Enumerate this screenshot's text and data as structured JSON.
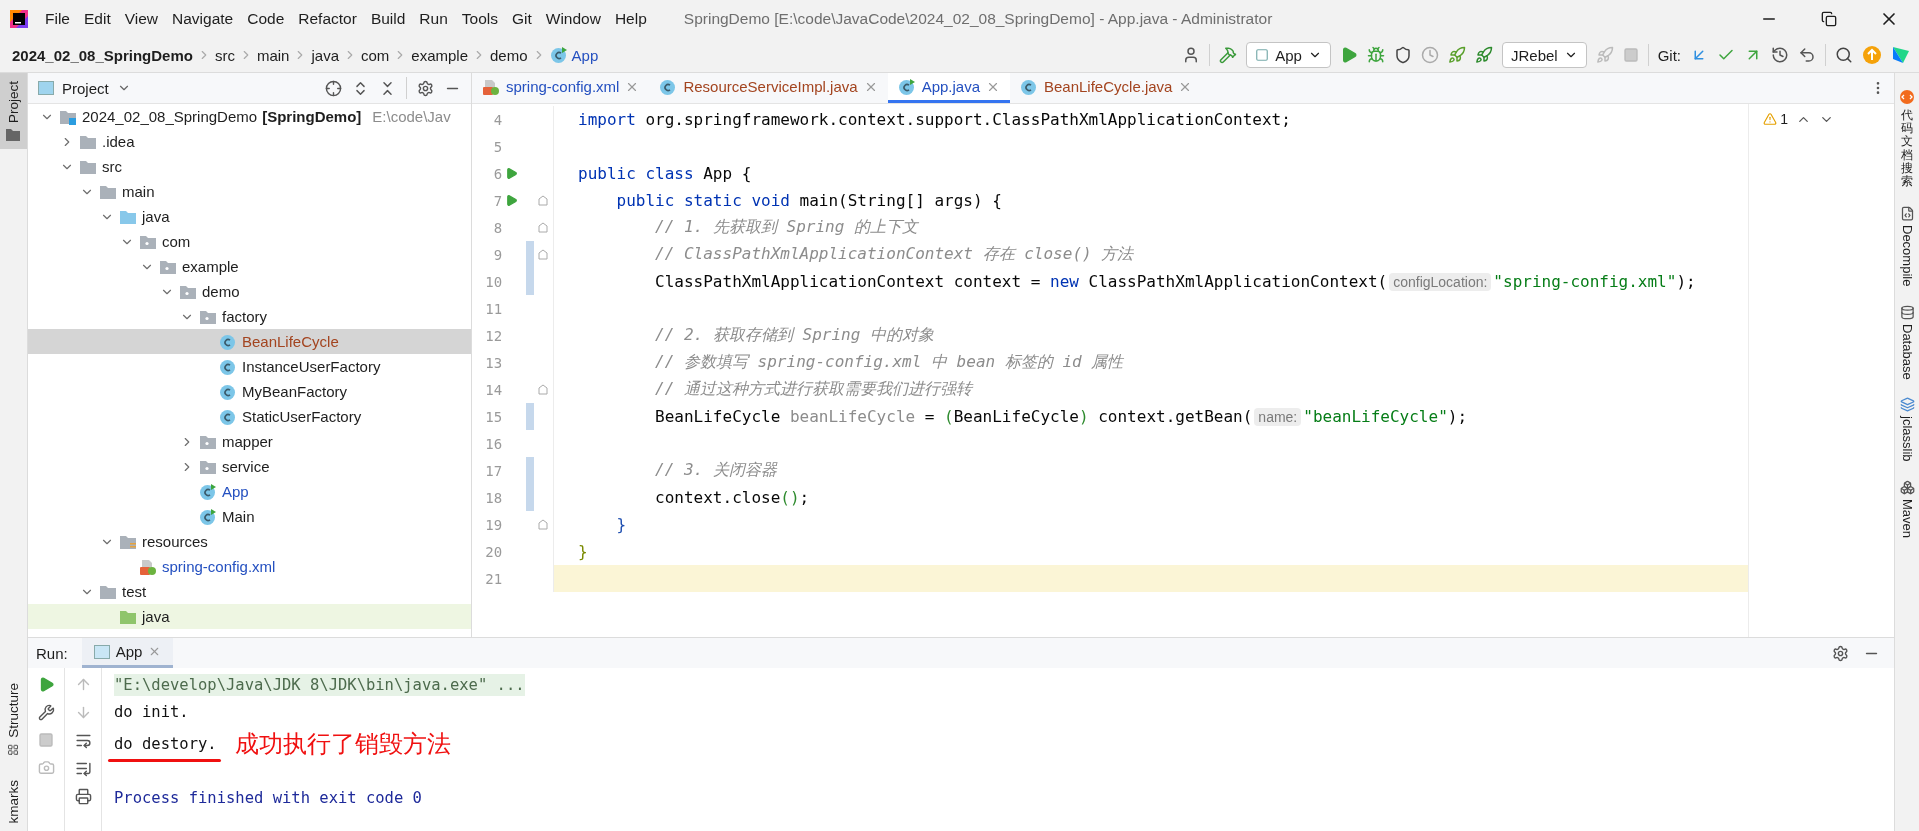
{
  "window": {
    "title": "SpringDemo [E:\\code\\JavaCode\\2024_02_08_SpringDemo] - App.java - Administrator"
  },
  "menu": [
    "File",
    "Edit",
    "View",
    "Navigate",
    "Code",
    "Refactor",
    "Build",
    "Run",
    "Tools",
    "Git",
    "Window",
    "Help"
  ],
  "breadcrumbs": [
    {
      "label": "2024_02_08_SpringDemo",
      "kind": "project"
    },
    {
      "label": "src",
      "kind": "folder"
    },
    {
      "label": "main",
      "kind": "folder"
    },
    {
      "label": "java",
      "kind": "folder"
    },
    {
      "label": "com",
      "kind": "folder"
    },
    {
      "label": "example",
      "kind": "folder"
    },
    {
      "label": "demo",
      "kind": "folder"
    },
    {
      "label": "App",
      "kind": "class"
    }
  ],
  "toolbar": {
    "run_config": "App",
    "jrebel_config": "JRebel",
    "git_label": "Git:"
  },
  "left_stripe": {
    "top": [
      {
        "label": "Project",
        "selected": true
      }
    ],
    "bottom": [
      {
        "label": "Structure",
        "selected": false
      },
      {
        "label": "kmarks",
        "selected": false
      }
    ]
  },
  "project_panel": {
    "title": "Project",
    "tree": [
      {
        "label": "2024_02_08_SpringDemo",
        "module": "[SpringDemo]",
        "path": "E:\\code\\Jav",
        "kind": "module",
        "selected": false,
        "expanded": true,
        "children": [
          {
            "label": ".idea",
            "kind": "folder",
            "selected": false,
            "expanded": false
          },
          {
            "label": "src",
            "kind": "folder",
            "selected": false,
            "expanded": true,
            "children": [
              {
                "label": "main",
                "kind": "folder",
                "selected": false,
                "expanded": true,
                "children": [
                  {
                    "label": "java",
                    "kind": "source",
                    "selected": false,
                    "expanded": true,
                    "children": [
                      {
                        "label": "com",
                        "kind": "package",
                        "selected": false,
                        "expanded": true,
                        "children": [
                          {
                            "label": "example",
                            "kind": "package",
                            "selected": false,
                            "expanded": true,
                            "children": [
                              {
                                "label": "demo",
                                "kind": "package",
                                "selected": false,
                                "expanded": true,
                                "children": [
                                  {
                                    "label": "factory",
                                    "kind": "package",
                                    "selected": false,
                                    "expanded": true,
                                    "children": [
                                      {
                                        "label": "BeanLifeCycle",
                                        "kind": "class",
                                        "color": "#a3441f",
                                        "selected": true
                                      },
                                      {
                                        "label": "InstanceUserFactory",
                                        "kind": "class",
                                        "selected": false
                                      },
                                      {
                                        "label": "MyBeanFactory",
                                        "kind": "class",
                                        "selected": false
                                      },
                                      {
                                        "label": "StaticUserFactory",
                                        "kind": "class",
                                        "selected": false
                                      }
                                    ]
                                  },
                                  {
                                    "label": "mapper",
                                    "kind": "package",
                                    "selected": false,
                                    "expanded": false
                                  },
                                  {
                                    "label": "service",
                                    "kind": "package",
                                    "selected": false,
                                    "expanded": false
                                  },
                                  {
                                    "label": "App",
                                    "kind": "main",
                                    "color": "#2450c0",
                                    "selected": false
                                  },
                                  {
                                    "label": "Main",
                                    "kind": "main",
                                    "selected": false
                                  }
                                ]
                              }
                            ]
                          }
                        ]
                      }
                    ]
                  },
                  {
                    "label": "resources",
                    "kind": "resources",
                    "selected": false,
                    "expanded": true,
                    "children": [
                      {
                        "label": "spring-config.xml",
                        "kind": "xml",
                        "color": "#2450c0",
                        "selected": false
                      }
                    ]
                  }
                ]
              },
              {
                "label": "test",
                "kind": "folder",
                "selected": false,
                "expanded": true,
                "children": [
                  {
                    "label": "java",
                    "kind": "test",
                    "selected": false
                  }
                ]
              }
            ]
          }
        ]
      }
    ]
  },
  "editor_tabs": [
    {
      "label": "spring-config.xml",
      "kind": "xml",
      "color": "#2450c0",
      "selected": false
    },
    {
      "label": "ResourceServiceImpl.java",
      "kind": "class",
      "color": "#a3441f",
      "selected": false
    },
    {
      "label": "App.java",
      "kind": "main",
      "color": "#2450c0",
      "selected": true
    },
    {
      "label": "BeanLifeCycle.java",
      "kind": "class",
      "color": "#a3441f",
      "selected": false
    }
  ],
  "editor": {
    "warnings": "1",
    "lines": [
      {
        "number": "4",
        "runnable": false,
        "fold": false,
        "changed": false,
        "current": false,
        "tokens": [
          {
            "kind": "keyword",
            "text": "import"
          },
          {
            "kind": "plain",
            "text": " org.springframework.context.support.ClassPathXmlApplicationContext;"
          }
        ]
      },
      {
        "number": "5",
        "runnable": false,
        "fold": false,
        "changed": false,
        "current": false
      },
      {
        "number": "6",
        "runnable": true,
        "fold": false,
        "changed": false,
        "current": false,
        "tokens": [
          {
            "kind": "keyword",
            "text": "public class"
          },
          {
            "kind": "plain",
            "text": " App {"
          }
        ]
      },
      {
        "number": "7",
        "runnable": true,
        "fold": true,
        "changed": false,
        "current": false,
        "tokens": [
          {
            "kind": "keyword",
            "text": "    public static void"
          },
          {
            "kind": "plain",
            "text": " main(String[] args) {"
          }
        ]
      },
      {
        "number": "8",
        "runnable": false,
        "fold": true,
        "changed": false,
        "current": false,
        "tokens": [
          {
            "kind": "comment",
            "text": "        // 1. 先获取到 Spring 的上下文"
          }
        ]
      },
      {
        "number": "9",
        "runnable": false,
        "fold": true,
        "changed": true,
        "current": false,
        "tokens": [
          {
            "kind": "comment",
            "text": "        // ClassPathXmlApplicationContext 存在 close() 方法"
          }
        ]
      },
      {
        "number": "10",
        "runnable": false,
        "fold": false,
        "changed": true,
        "current": false,
        "tokens": [
          {
            "kind": "plain",
            "text": "        ClassPathXmlApplicationContext context = "
          },
          {
            "kind": "keyword",
            "text": "new"
          },
          {
            "kind": "plain",
            "text": " ClassPathXmlApplicationContext("
          },
          {
            "kind": "hint",
            "text": "configLocation:"
          },
          {
            "kind": "string",
            "text": "\"spring-config.xml\""
          },
          {
            "kind": "plain",
            "text": ");"
          }
        ]
      },
      {
        "number": "11",
        "runnable": false,
        "fold": false,
        "changed": false,
        "current": false
      },
      {
        "number": "12",
        "runnable": false,
        "fold": false,
        "changed": false,
        "current": false,
        "tokens": [
          {
            "kind": "comment",
            "text": "        // 2. 获取存储到 Spring 中的对象"
          }
        ]
      },
      {
        "number": "13",
        "runnable": false,
        "fold": false,
        "changed": false,
        "current": false,
        "tokens": [
          {
            "kind": "comment",
            "text": "        // 参数填写 spring-config.xml 中 bean 标签的 id 属性"
          }
        ]
      },
      {
        "number": "14",
        "runnable": false,
        "fold": true,
        "changed": false,
        "current": false,
        "tokens": [
          {
            "kind": "comment",
            "text": "        // 通过这种方式进行获取需要我们进行强转"
          }
        ]
      },
      {
        "number": "15",
        "runnable": false,
        "fold": false,
        "changed": true,
        "current": false,
        "tokens": [
          {
            "kind": "plain",
            "text": "        BeanLifeCycle "
          },
          {
            "kind": "unused",
            "text": "beanLifeCycle"
          },
          {
            "kind": "plain",
            "text": " = "
          },
          {
            "kind": "bracket",
            "color": "#2e8b2e",
            "text": "("
          },
          {
            "kind": "plain",
            "text": "BeanLifeCycle"
          },
          {
            "kind": "bracket",
            "color": "#2e8b2e",
            "text": ")"
          },
          {
            "kind": "plain",
            "text": " context.getBean("
          },
          {
            "kind": "hint",
            "text": "name:"
          },
          {
            "kind": "string",
            "text": "\"beanLifeCycle\""
          },
          {
            "kind": "plain",
            "text": ");"
          }
        ]
      },
      {
        "number": "16",
        "runnable": false,
        "fold": false,
        "changed": false,
        "current": false
      },
      {
        "number": "17",
        "runnable": false,
        "fold": false,
        "changed": true,
        "current": false,
        "tokens": [
          {
            "kind": "comment",
            "text": "        // 3. 关闭容器"
          }
        ]
      },
      {
        "number": "18",
        "runnable": false,
        "fold": false,
        "changed": true,
        "current": false,
        "tokens": [
          {
            "kind": "plain",
            "text": "        context.close"
          },
          {
            "kind": "bracket",
            "color": "#2e8b2e",
            "text": "()"
          },
          {
            "kind": "plain",
            "text": ";"
          }
        ]
      },
      {
        "number": "19",
        "runnable": false,
        "fold": true,
        "changed": false,
        "current": false,
        "tokens": [
          {
            "kind": "bracket",
            "color": "#1f4fb0",
            "text": "    }"
          }
        ]
      },
      {
        "number": "20",
        "runnable": false,
        "fold": false,
        "changed": false,
        "current": false,
        "tokens": [
          {
            "kind": "bracket",
            "color": "#7a8a00",
            "text": "}"
          }
        ]
      },
      {
        "number": "21",
        "runnable": false,
        "fold": false,
        "changed": false,
        "current": true
      }
    ]
  },
  "right_stripe": [
    "代码文档搜索",
    "Decompile",
    "Database",
    "jclasslib",
    "Maven"
  ],
  "run_panel": {
    "label": "Run:",
    "tabs": [
      {
        "label": "App",
        "selected": true
      }
    ],
    "console": [
      {
        "kind": "command",
        "text": "\"E:\\develop\\Java\\JDK 8\\JDK\\bin\\java.exe\" ..."
      },
      {
        "kind": "output",
        "text": "do init."
      },
      {
        "kind": "output",
        "text": "do destory.",
        "annotation": "成功执行了销毁方法"
      },
      {
        "kind": "exit",
        "text": "Process finished with exit code 0"
      }
    ]
  }
}
